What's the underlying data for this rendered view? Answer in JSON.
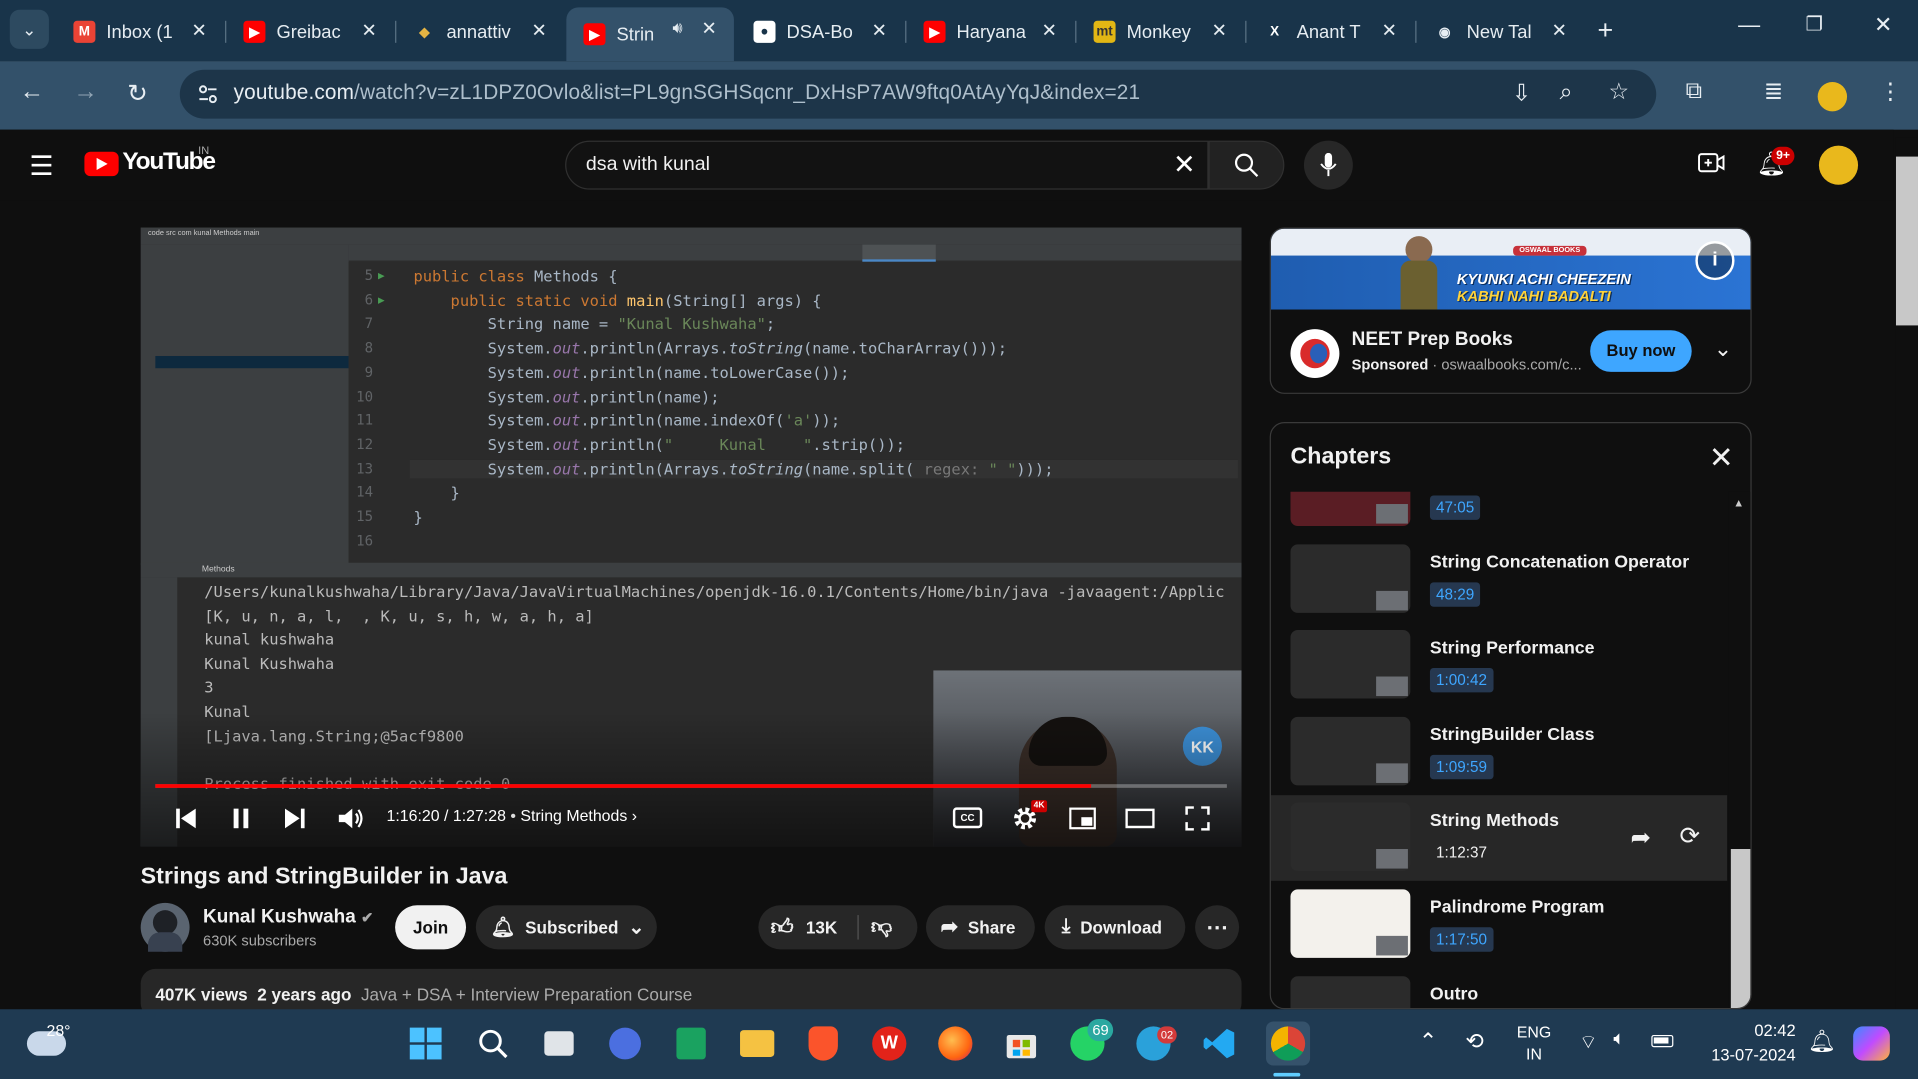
{
  "browser": {
    "tabs": [
      {
        "label": "Inbox (1",
        "icon": "gmail-icon"
      },
      {
        "label": "Greibac",
        "icon": "youtube-icon"
      },
      {
        "label": "annattiv",
        "icon": "site-icon"
      },
      {
        "label": "Strin",
        "icon": "youtube-icon",
        "active": true
      },
      {
        "label": "DSA-Bo",
        "icon": "github-icon"
      },
      {
        "label": "Haryana",
        "icon": "youtube-icon"
      },
      {
        "label": "Monkey",
        "icon": "monkeytype-icon"
      },
      {
        "label": "Anant T",
        "icon": "x-icon"
      },
      {
        "label": "New Tal",
        "icon": "chrome-icon"
      }
    ],
    "url_host": "youtube.com",
    "url_path": "/watch?v=zL1DPZ0Ovlo&list=PL9gnSGHSqcnr_DxHsP7AW9ftq0AtAyYqJ&index=21",
    "colors": {
      "tabstrip": "#19344a",
      "toolbar": "#33516a"
    }
  },
  "youtube": {
    "logo": "YouTube",
    "country": "IN",
    "search_value": "dsa with kunal",
    "notification_count": "9+"
  },
  "video": {
    "ide_header": "code  src  com  kunal  Methods  main",
    "code_lines": [
      {
        "n": "5",
        "html": "<span class=\"kw\">public class</span> Methods {"
      },
      {
        "n": "6",
        "html": "    <span class=\"kw\">public static void</span> <span class=\"fn\">main</span>(String[] args) {"
      },
      {
        "n": "7",
        "html": "        String name = <span class=\"st\">\"Kunal Kushwaha\"</span>;"
      },
      {
        "n": "8",
        "html": "        System.<span class=\"it\">out</span>.println(Arrays.<i>toString</i>(name.toCharArray()));"
      },
      {
        "n": "9",
        "html": "        System.<span class=\"it\">out</span>.println(name.toLowerCase());"
      },
      {
        "n": "10",
        "html": "        System.<span class=\"it\">out</span>.println(name);"
      },
      {
        "n": "11",
        "html": "        System.<span class=\"it\">out</span>.println(name.indexOf(<span class=\"st\">'a'</span>));"
      },
      {
        "n": "12",
        "html": "        System.<span class=\"it\">out</span>.println(<span class=\"st\">\"     Kunal    \"</span>.strip());"
      },
      {
        "n": "13",
        "html": "        System.<span class=\"it\">out</span>.println(Arrays.<i>toString</i>(name.split( <span style=\"color:#787878\">regex:</span> <span class=\"st\">\" \"</span>)));"
      },
      {
        "n": "14",
        "html": "    }"
      },
      {
        "n": "15",
        "html": "}"
      },
      {
        "n": "16",
        "html": ""
      }
    ],
    "console_lines": [
      "/Users/kunalkushwaha/Library/Java/JavaVirtualMachines/openjdk-16.0.1/Contents/Home/bin/java -javaagent:/Applic",
      "[K, u, n, a, l,  , K, u, s, h, w, a, h, a]",
      "kunal kushwaha",
      "Kunal Kushwaha",
      "3",
      "Kunal",
      "[Ljava.lang.String;@5acf9800",
      "",
      "Process finished with exit code 0"
    ],
    "run_label": "Methods",
    "current_time": "1:16:20",
    "duration": "1:27:28",
    "chapter": "String Methods",
    "progress": 0.8728,
    "channel_badge": "KK"
  },
  "meta": {
    "title": "Strings and StringBuilder in Java",
    "channel": "Kunal Kushwaha",
    "subscribers": "630K subscribers",
    "join": "Join",
    "subscribed": "Subscribed",
    "likes": "13K",
    "share": "Share",
    "download": "Download",
    "views": "407K views",
    "age": "2 years ago",
    "playlist": "Java + DSA + Interview Preparation Course"
  },
  "ad": {
    "banner_line1": "KYUNKI ACHI CHEEZEIN",
    "banner_line2": "KABHI NAHI BADALTI",
    "banner_brand": "OSWAAL BOOKS",
    "title": "NEET Prep Books",
    "sponsored": "Sponsored",
    "domain": "oswaalbooks.com/c...",
    "cta": "Buy now"
  },
  "chapters": {
    "heading": "Chapters",
    "items": [
      {
        "title": "",
        "time": "47:05"
      },
      {
        "title": "String Concatenation Operator",
        "time": "48:29"
      },
      {
        "title": "String Performance",
        "time": "1:00:42"
      },
      {
        "title": "StringBuilder Class",
        "time": "1:09:59"
      },
      {
        "title": "String Methods",
        "time": "1:12:37",
        "active": true
      },
      {
        "title": "Palindrome Program",
        "time": "1:17:50"
      },
      {
        "title": "Outro",
        "time": ""
      }
    ]
  },
  "taskbar": {
    "weather": "28°",
    "lang1": "ENG",
    "lang2": "IN",
    "time": "02:42",
    "date": "13-07-2024",
    "whatsapp_badge": "69",
    "telegram_badge": "02"
  }
}
